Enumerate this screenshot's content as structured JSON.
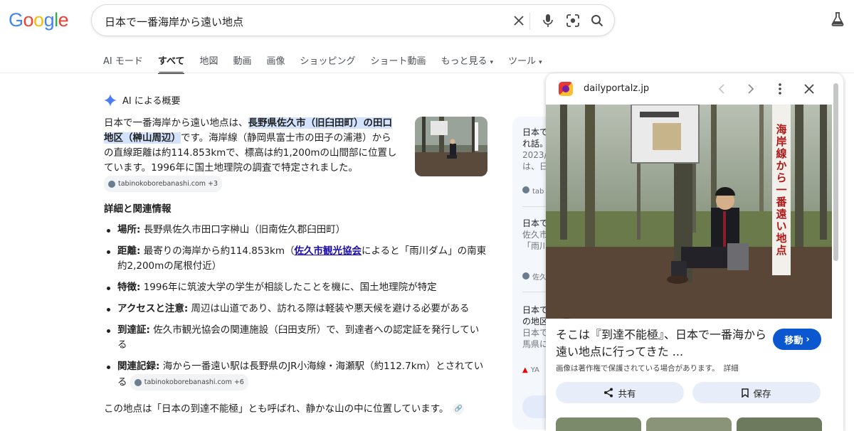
{
  "logo": {
    "letters": [
      "G",
      "o",
      "o",
      "g",
      "l",
      "e"
    ],
    "colors": [
      "#4285f4",
      "#ea4335",
      "#fbbc05",
      "#4285f4",
      "#34a853",
      "#ea4335"
    ]
  },
  "search": {
    "query": "日本で一番海岸から遠い地点"
  },
  "tabs": [
    {
      "label": "AI モード",
      "active": false
    },
    {
      "label": "すべて",
      "active": true
    },
    {
      "label": "地図",
      "active": false
    },
    {
      "label": "動画",
      "active": false
    },
    {
      "label": "画像",
      "active": false
    },
    {
      "label": "ショッピング",
      "active": false
    },
    {
      "label": "ショート動画",
      "active": false
    },
    {
      "label": "もっと見る",
      "active": false,
      "dropdown": true
    },
    {
      "label": "ツール",
      "active": false,
      "dropdown": true
    }
  ],
  "ai_overview": {
    "heading": "AI による概要",
    "para_prefix": "日本で一番海岸から遠い地点は、",
    "para_highlight": "長野県佐久市（旧臼田町）の田口地区（榊山周辺）",
    "para_rest": "です。海岸線（静岡県富士市の田子の浦港）からの直線距離は約114.853kmで、標高は約1,200mの山間部に位置しています。1996年に国土地理院の調査で特定されました。",
    "chip_label": "tabinokoborebanashi.com +3",
    "section_title": "詳細と関連情報",
    "bullets": [
      {
        "label": "場所:",
        "text": " 長野県佐久市田口字榊山（旧南佐久郡臼田町）"
      },
      {
        "label": "距離:",
        "text_before": " 最寄りの海岸から約114.853km（",
        "link": "佐久市観光協会",
        "text_after": "によると「雨川ダム」の南東約2,200mの尾根付近）"
      },
      {
        "label": "特徴:",
        "text": " 1996年に筑波大学の学生が相談したことを機に、国土地理院が特定"
      },
      {
        "label": "アクセスと注意:",
        "text": " 周辺は山道であり、訪れる際は軽装や悪天候を避ける必要がある"
      },
      {
        "label": "到達証:",
        "text": " 佐久市観光協会の関連施設（臼田支所）で、到達者への認定証を発行している"
      },
      {
        "label": "関連記録:",
        "text": " 海から一番遠い駅は長野県のJR小海線・海瀬駅（約112.7km）とされている",
        "chip": "tabinokoborebanashi.com +6"
      }
    ],
    "closing": "この地点は「日本の到達不能極」とも呼ばれ、静かな山の中に位置しています。"
  },
  "sources": {
    "items": [
      {
        "line1": "日本で",
        "line2": "れ話。",
        "line3": "2023/0",
        "line4": "は、日"
      },
      {
        "site": "tab"
      },
      {
        "line1": "日本で",
        "line2": "佐久市",
        "line3": "「雨川"
      },
      {
        "site": "佐久"
      },
      {
        "line1": "日本で",
        "line2": "の地区",
        "line3": "日本で",
        "line4": "馬県に"
      },
      {
        "site": "YA"
      }
    ]
  },
  "preview": {
    "site": "dailyportalz.jp",
    "title": "そこは『到達不能極』、日本で一番海から遠い地点に行ってきた ...",
    "visit_label": "移動",
    "copyright": "画像は著作権で保護されている場合があります。",
    "more": "詳細",
    "share_label": "共有",
    "save_label": "保存",
    "sign_text": "海岸線から一番遠い地点"
  },
  "colors": {
    "accent": "#0b57d0",
    "highlight": "#d3e3fd",
    "link": "#1a0dab"
  }
}
